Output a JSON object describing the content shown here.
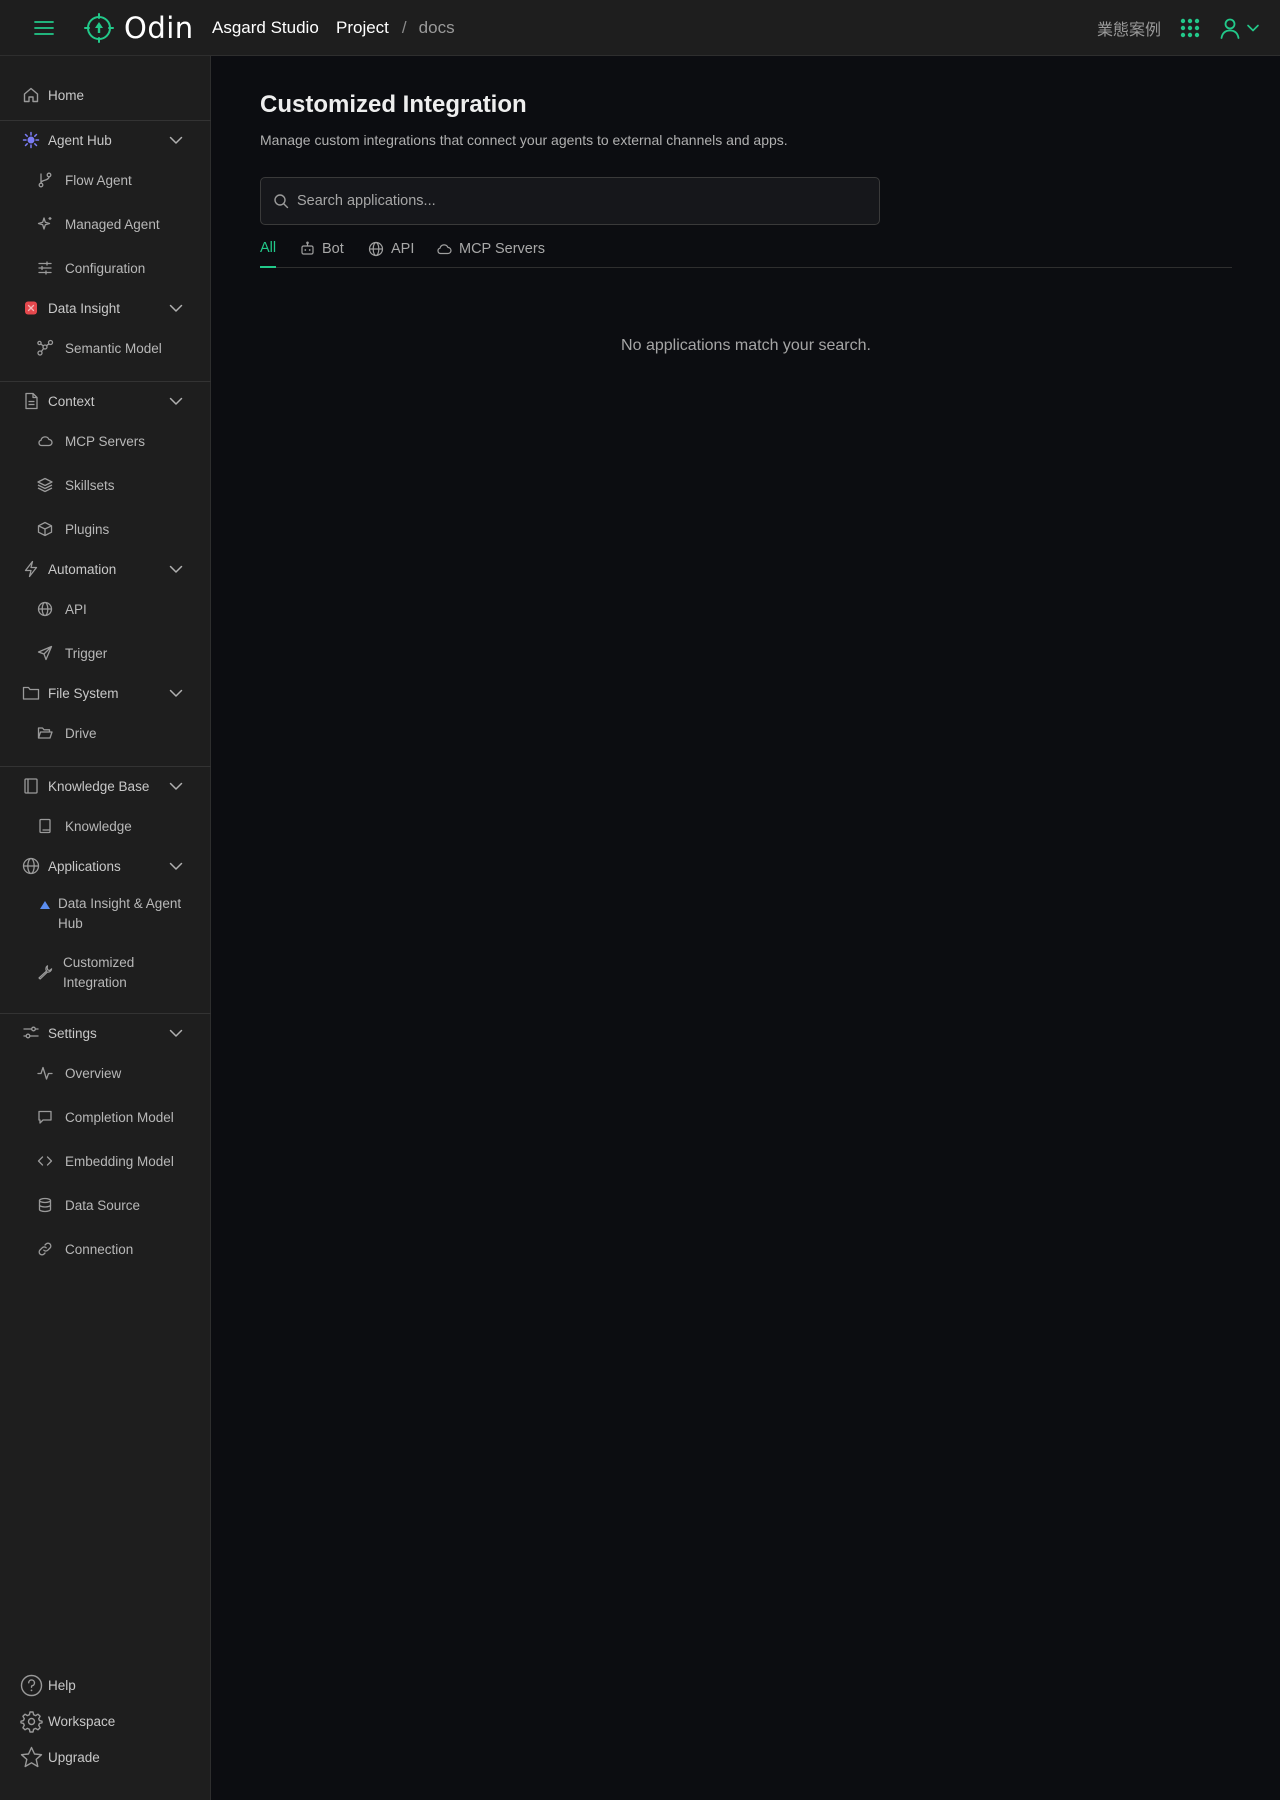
{
  "header": {
    "brand": "Odin",
    "org": "Asgard Studio",
    "breadcrumb": {
      "project": "Project",
      "separator": "/",
      "current": "docs"
    },
    "case_link": "業態案例"
  },
  "sidebar": {
    "home": "Home",
    "agent_hub": {
      "label": "Agent Hub",
      "items": [
        "Flow Agent",
        "Managed Agent",
        "Configuration"
      ]
    },
    "data_insight": {
      "label": "Data Insight",
      "items": [
        "Semantic Model"
      ]
    },
    "context": {
      "label": "Context",
      "items": [
        "MCP Servers",
        "Skillsets",
        "Plugins"
      ]
    },
    "automation": {
      "label": "Automation",
      "items": [
        "API",
        "Trigger"
      ]
    },
    "file_system": {
      "label": "File System",
      "items": [
        "Drive"
      ]
    },
    "knowledge_base": {
      "label": "Knowledge Base",
      "items": [
        "Knowledge"
      ]
    },
    "applications": {
      "label": "Applications",
      "items": [
        "Data Insight & Agent Hub",
        "Customized Integration"
      ]
    },
    "settings": {
      "label": "Settings",
      "items": [
        "Overview",
        "Completion Model",
        "Embedding Model",
        "Data Source",
        "Connection"
      ]
    },
    "footer": {
      "help": "Help",
      "workspace": "Workspace",
      "upgrade": "Upgrade"
    }
  },
  "main": {
    "title": "Customized Integration",
    "description": "Manage custom integrations that connect your agents to external channels and apps.",
    "search": {
      "placeholder": "Search applications...",
      "value": ""
    },
    "tabs": [
      {
        "label": "All",
        "active": true
      },
      {
        "label": "Bot",
        "icon": "bot-icon"
      },
      {
        "label": "API",
        "icon": "globe-icon"
      },
      {
        "label": "MCP Servers",
        "icon": "cloud-icon"
      }
    ],
    "empty_message": "No applications match your search."
  },
  "colors": {
    "accent": "#22c98a",
    "background": "#0c0d11",
    "sidebar": "#1e1e1e",
    "agent_hub_icon": "#7b7cf5",
    "data_insight_icon": "#e5484d",
    "applications_item_icon": "#5b8def"
  }
}
